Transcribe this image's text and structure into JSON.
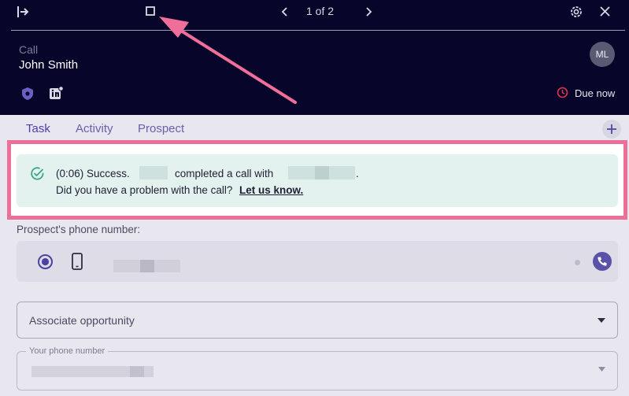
{
  "header": {
    "pager_text": "1 of 2",
    "task_type": "Call",
    "contact_name": "John Smith",
    "avatar_initials": "ML",
    "due_label": "Due now",
    "bg_color": "#07062a"
  },
  "tabs": [
    {
      "label": "Task",
      "active": true
    },
    {
      "label": "Activity",
      "active": false
    },
    {
      "label": "Prospect",
      "active": false
    }
  ],
  "banner": {
    "duration_success": "(0:06) Success.",
    "completed_text": "completed a call with",
    "period": ".",
    "question": "Did you have a problem with the call?",
    "link_text": "Let us know."
  },
  "form": {
    "phone_label": "Prospect's phone number:",
    "associate_placeholder": "Associate opportunity",
    "your_phone_label": "Your phone number"
  },
  "colors": {
    "accent": "#5a4cc0",
    "highlight_border": "#ec6f97",
    "annotation_arrow": "#f06e9a",
    "success": "#3aa58c",
    "due_clock": "#e0334b"
  },
  "icons": [
    "exit-icon",
    "expand-icon",
    "chevron-left-icon",
    "chevron-right-icon",
    "gear-icon",
    "close-icon",
    "shield-icon",
    "linkedin-icon",
    "clock-icon",
    "plus-icon",
    "check-circle-icon",
    "radio-selected-icon",
    "mobile-phone-icon",
    "phone-icon",
    "caret-down-icon"
  ]
}
